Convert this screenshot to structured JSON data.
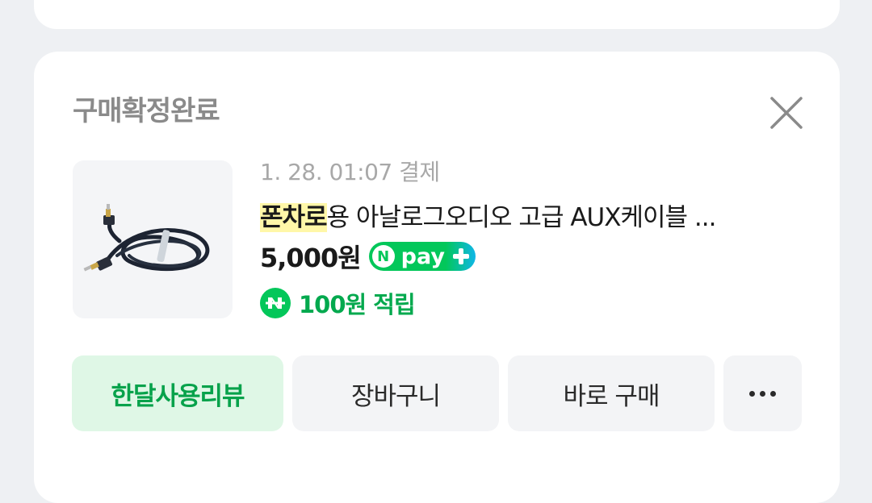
{
  "order": {
    "status": "구매확정완료",
    "date": "1. 28. 01:07 결제",
    "title_highlight": "폰차로",
    "title_rest": "용 아날로그오디오 고급 AUX케이블 ...",
    "price": "5,000원",
    "npay_label": "pay",
    "npay_n": "N",
    "point": "100원 적립",
    "thumbnail": "aux-cable-image"
  },
  "actions": {
    "review": "한달사용리뷰",
    "cart": "장바구니",
    "buy": "바로 구매",
    "more_icon": "more-dots-icon"
  },
  "colors": {
    "naver_green": "#03c75a",
    "review_bg": "#dff7e6",
    "highlight": "#fff7a8",
    "page_bg": "#eef0f3"
  }
}
